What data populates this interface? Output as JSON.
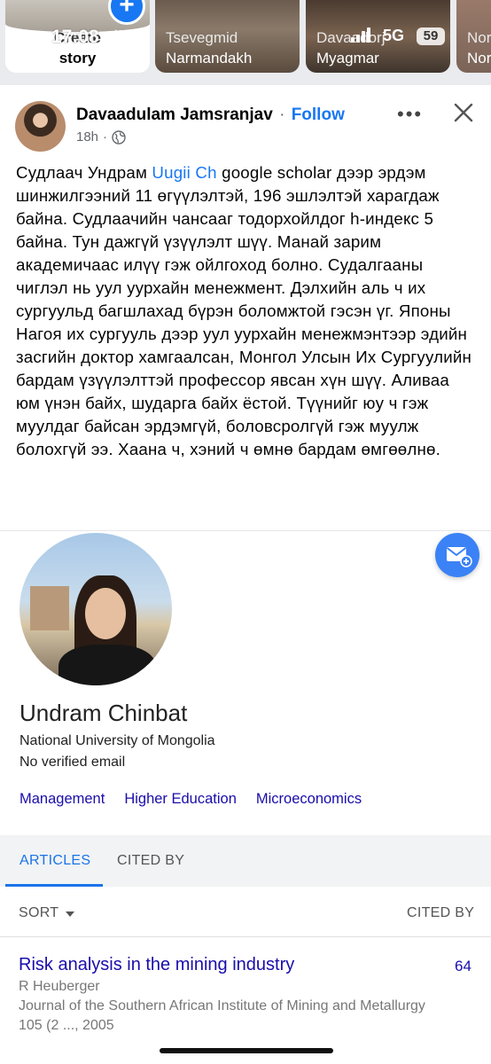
{
  "status_bar": {
    "time": "17:08",
    "network": "5G",
    "battery": "59"
  },
  "stories": {
    "create": {
      "line1": "Create",
      "line2": "story"
    },
    "items": [
      {
        "first": "Tsevegmid",
        "last": "Narmandakh"
      },
      {
        "first": "Davaadorj",
        "last": "Myagmar"
      },
      {
        "first": "Nor",
        "last": "Nor"
      }
    ]
  },
  "post": {
    "author": "Davaadulam Jamsranjav",
    "separator": "·",
    "follow": "Follow",
    "time": "18h",
    "meta_separator": "·",
    "text_before_mention": "Судлаач Ундрам ",
    "mention": "Uugii Ch",
    "text_after_mention": "  google scholar дээр эрдэм шинжилгээний 11 өгүүлэлтэй, 196 эшлэлтэй харагдаж байна. Судлаачийн чансааг тодорхойлдог h-индекс 5 байна.  Тун дажгүй үзүүлэлт шүү. Манай зарим академичаас илүү гэж ойлгоход болно. Судалгааны чиглэл нь уул уурхайн менежмент. Дэлхийн аль ч их сургуульд багшлахад бүрэн боломжтой гэсэн үг. Японы Нагоя их сургууль дээр уул уурхайн менежмэнтээр эдийн засгийн доктор хамгаалсан, Монгол Улсын Их Сургуулийн бардам үзүүлэлттэй профессор явсан хүн шүү. Аливаа юм үнэн байх, шударга байх ёстой. Түүнийг юу ч гэж муулдаг байсан эрдэмгүй, боловсролгүй гэж муулж болохгүй ээ. Хаана ч, хэний ч өмнө бардам өмгөөлнө."
  },
  "scholar": {
    "name": "Undram Chinbat",
    "affiliation": "National University of Mongolia",
    "email_status": "No verified email",
    "topics": [
      "Management",
      "Higher Education",
      "Microeconomics"
    ],
    "tabs": {
      "articles": "ARTICLES",
      "cited_by": "CITED BY"
    },
    "sort_label": "SORT",
    "cited_by_header": "CITED BY",
    "articles": [
      {
        "title": "Risk analysis in the mining industry",
        "authors": "R Heuberger",
        "venue": "Journal of the Southern African Institute of Mining and Metallurgy 105 (2 ..., 2005",
        "cited_by": "64"
      }
    ]
  },
  "colors": {
    "facebook_blue": "#1877f2",
    "scholar_link": "#1a0dab",
    "scholar_tab": "#1a73e8"
  }
}
